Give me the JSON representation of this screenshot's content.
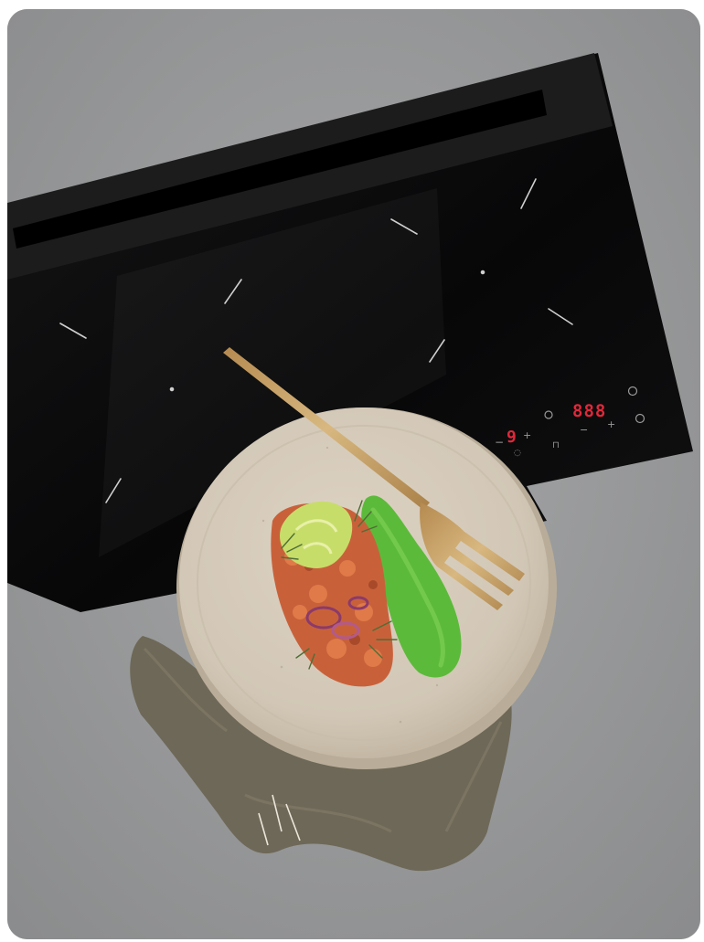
{
  "image": {
    "subject": "black induction cooktop with a plate of food, gold fork and linen cloth on a grey stone counter"
  },
  "cooktop": {
    "zone_level": "9",
    "timer": "888"
  },
  "colors": {
    "counter": "#9a9b9c",
    "glass": "#0b0b0c",
    "display_red": "#e0283a",
    "plate": "#d7cdbd",
    "puree": "#5cba3a",
    "fork": "#c9a56a",
    "cloth": "#6e6858"
  }
}
